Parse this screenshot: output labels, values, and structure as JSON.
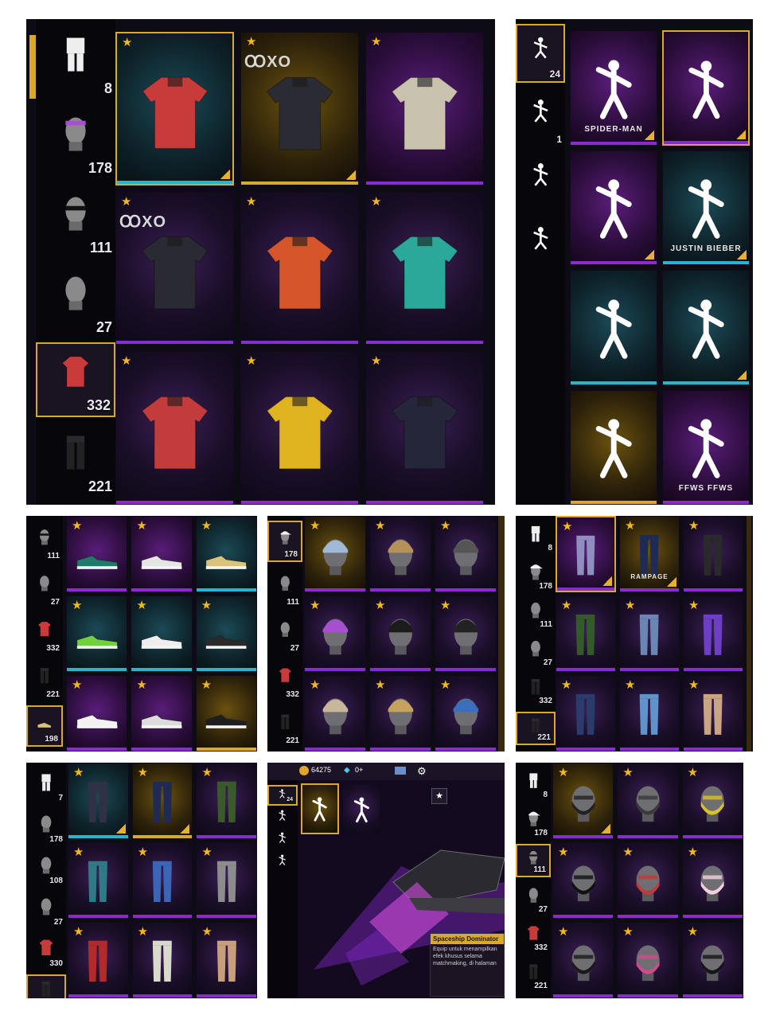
{
  "panel_a": {
    "sidebar": [
      {
        "icon": "outfit-icon",
        "count": "8"
      },
      {
        "icon": "headband-icon",
        "count": "178"
      },
      {
        "icon": "sunglasses-head-icon",
        "count": "111"
      },
      {
        "icon": "mask-head-icon",
        "count": "27"
      },
      {
        "icon": "top-shirt-icon",
        "count": "332"
      },
      {
        "icon": "pants-icon",
        "count": "221"
      }
    ],
    "items": [
      {
        "name": "shark-shirt",
        "color": "#c83b3b"
      },
      {
        "name": "logo-coat",
        "color": "#2b2b33"
      },
      {
        "name": "white-trench-coat",
        "color": "#c9c2ae"
      },
      {
        "name": "logo-hoodie",
        "color": "#2a2a33"
      },
      {
        "name": "orange-jacket",
        "color": "#d5562a"
      },
      {
        "name": "teal-jacket",
        "color": "#2ca89a"
      },
      {
        "name": "plaid-vest",
        "color": "#c43b3b"
      },
      {
        "name": "sio-tank-top",
        "color": "#e0b321"
      },
      {
        "name": "varsity-vest",
        "color": "#25263a"
      }
    ],
    "logo_text": "ꝎXO"
  },
  "panel_b": {
    "sidebar": [
      {
        "icon": "pose-icon",
        "count": "24"
      },
      {
        "icon": "action-icon",
        "count": "1"
      },
      {
        "icon": "emote-icon",
        "count": ""
      },
      {
        "icon": "victory-icon",
        "count": ""
      }
    ],
    "items": [
      {
        "name": "spider-man-emote",
        "label": "SPIDER-MAN"
      },
      {
        "name": "dance-emote",
        "label": ""
      },
      {
        "name": "kick-emote",
        "label": ""
      },
      {
        "name": "justin-bieber-emote",
        "label": "JUSTIN BIEBER"
      },
      {
        "name": "arms-up-emote",
        "label": ""
      },
      {
        "name": "salute-emote",
        "label": ""
      },
      {
        "name": "gold-dance-emote",
        "label": ""
      },
      {
        "name": "ffws-emote",
        "label": "FFWS FFWS"
      }
    ]
  },
  "panel_c": {
    "sidebar": [
      {
        "icon": "sunglasses-head-icon",
        "count": "111"
      },
      {
        "icon": "mask-head-icon",
        "count": "27"
      },
      {
        "icon": "jersey-icon",
        "count": "332"
      },
      {
        "icon": "shorts-icon",
        "count": "221"
      },
      {
        "icon": "shoes-icon",
        "count": "198"
      }
    ],
    "items": [
      {
        "name": "green-sandals",
        "color": "#1f7a6a"
      },
      {
        "name": "white-sneakers",
        "color": "#e4e4e4"
      },
      {
        "name": "gold-sandals",
        "color": "#d9c27a"
      },
      {
        "name": "neon-runners",
        "color": "#6fd13c"
      },
      {
        "name": "white-high-tops",
        "color": "#eeeeee"
      },
      {
        "name": "black-converse",
        "color": "#2a2a2a"
      },
      {
        "name": "red-white-sneakers",
        "color": "#f2f2f2"
      },
      {
        "name": "silver-sneakers",
        "color": "#dcdcdc"
      },
      {
        "name": "black-boots",
        "color": "#1e1e1e"
      }
    ]
  },
  "panel_d": {
    "sidebar": [
      {
        "icon": "hat-head-icon",
        "count": "178"
      },
      {
        "icon": "head-icon",
        "count": "111"
      },
      {
        "icon": "mask-head-icon",
        "count": "27"
      },
      {
        "icon": "jacket-icon",
        "count": "332"
      },
      {
        "icon": "pants-icon",
        "count": "221"
      }
    ],
    "items": [
      {
        "name": "blue-hair",
        "color": "#9fb9d6"
      },
      {
        "name": "straw-hat",
        "color": "#b4925a"
      },
      {
        "name": "gray-cap",
        "color": "#555"
      },
      {
        "name": "purple-headband",
        "color": "#a64fd1"
      },
      {
        "name": "black-hair",
        "color": "#1c1c1c"
      },
      {
        "name": "black-bandana",
        "color": "#222"
      },
      {
        "name": "blonde-hair",
        "color": "#c9b79a"
      },
      {
        "name": "conical-hat",
        "color": "#c5a35e"
      },
      {
        "name": "blue-hood",
        "color": "#3b6fbd"
      }
    ]
  },
  "panel_e": {
    "sidebar": [
      {
        "icon": "outfit-icon",
        "count": "8"
      },
      {
        "icon": "cap-icon",
        "count": "178"
      },
      {
        "icon": "head-icon",
        "count": "111"
      },
      {
        "icon": "mask-head-icon",
        "count": "27"
      },
      {
        "icon": "shorts-icon",
        "count": "332"
      },
      {
        "icon": "skirt-icon",
        "count": "221"
      }
    ],
    "items": [
      {
        "name": "pleated-skirt",
        "color": "#8f8fbf",
        "label": ""
      },
      {
        "name": "rampage-pants",
        "color": "#1f2a55",
        "label": "RAMPAGE"
      },
      {
        "name": "camo-pants",
        "color": "#2a2a2a",
        "label": ""
      },
      {
        "name": "green-tech-pants",
        "color": "#355a2a",
        "label": ""
      },
      {
        "name": "ripped-jeans",
        "color": "#6b86b3",
        "label": ""
      },
      {
        "name": "purple-briefs",
        "color": "#6c3fc4",
        "label": ""
      },
      {
        "name": "floral-pants",
        "color": "#2b3b6b",
        "label": ""
      },
      {
        "name": "light-jeans",
        "color": "#5f93c9",
        "label": ""
      },
      {
        "name": "khaki-shorts",
        "color": "#c9a583",
        "label": ""
      }
    ]
  },
  "panel_f": {
    "sidebar": [
      {
        "icon": "outfit-icon",
        "count": "7"
      },
      {
        "icon": "mask-head-icon",
        "count": "178"
      },
      {
        "icon": "balaclava-icon",
        "count": "108"
      },
      {
        "icon": "bald-head-icon",
        "count": "27"
      },
      {
        "icon": "tank-top-icon",
        "count": "330"
      },
      {
        "icon": "pants-icon",
        "count": ""
      }
    ],
    "items": [
      {
        "name": "graffiti-pants",
        "color": "#303046"
      },
      {
        "name": "logo-pants",
        "color": "#1f2a55"
      },
      {
        "name": "green-tech-pants",
        "color": "#3a5a2a"
      },
      {
        "name": "teal-jeans",
        "color": "#2f7a86"
      },
      {
        "name": "flag-shorts",
        "color": "#3b66b8"
      },
      {
        "name": "gray-joggers",
        "color": "#8c8c8c"
      },
      {
        "name": "flame-pants",
        "color": "#b22a2a"
      },
      {
        "name": "white-baggy-pants",
        "color": "#d9d9cc"
      },
      {
        "name": "tan-cargo",
        "color": "#c7a07a"
      }
    ]
  },
  "panel_g": {
    "top_bar": {
      "coins": "64275",
      "diamonds": "0+"
    },
    "sidebar": [
      {
        "icon": "pose-icon",
        "count": "24"
      },
      {
        "icon": "action-icon",
        "count": ""
      },
      {
        "icon": "emote-icon",
        "count": ""
      },
      {
        "icon": "victory-icon",
        "count": ""
      }
    ],
    "items": [
      {
        "name": "spaceship-emote"
      },
      {
        "name": "slide-emote"
      }
    ],
    "tooltip": {
      "title": "Spaceship Dominator",
      "body": "Equip untuk menampilkan efek khusus selama matchmaking, di halaman"
    }
  },
  "panel_h": {
    "sidebar": [
      {
        "icon": "outfit-icon",
        "count": "8"
      },
      {
        "icon": "cap-icon",
        "count": "178"
      },
      {
        "icon": "sunglasses-head-icon",
        "count": "111"
      },
      {
        "icon": "mask-head-icon",
        "count": "27"
      },
      {
        "icon": "jacket-icon",
        "count": "332"
      },
      {
        "icon": "pants-icon",
        "count": "221"
      }
    ],
    "items": [
      {
        "name": "black-mask",
        "color": "#222"
      },
      {
        "name": "gas-mask",
        "color": "#3a3a3a"
      },
      {
        "name": "yellow-helmet",
        "color": "#d9c22a"
      },
      {
        "name": "sunglasses",
        "color": "#111"
      },
      {
        "name": "robot-helmet",
        "color": "#c23b3b"
      },
      {
        "name": "bunny-mask",
        "color": "#f2d1dc"
      },
      {
        "name": "ski-mask",
        "color": "#1a1a1a"
      },
      {
        "name": "pink-goggles",
        "color": "#d24a8c"
      },
      {
        "name": "black-visor",
        "color": "#161616"
      }
    ]
  }
}
